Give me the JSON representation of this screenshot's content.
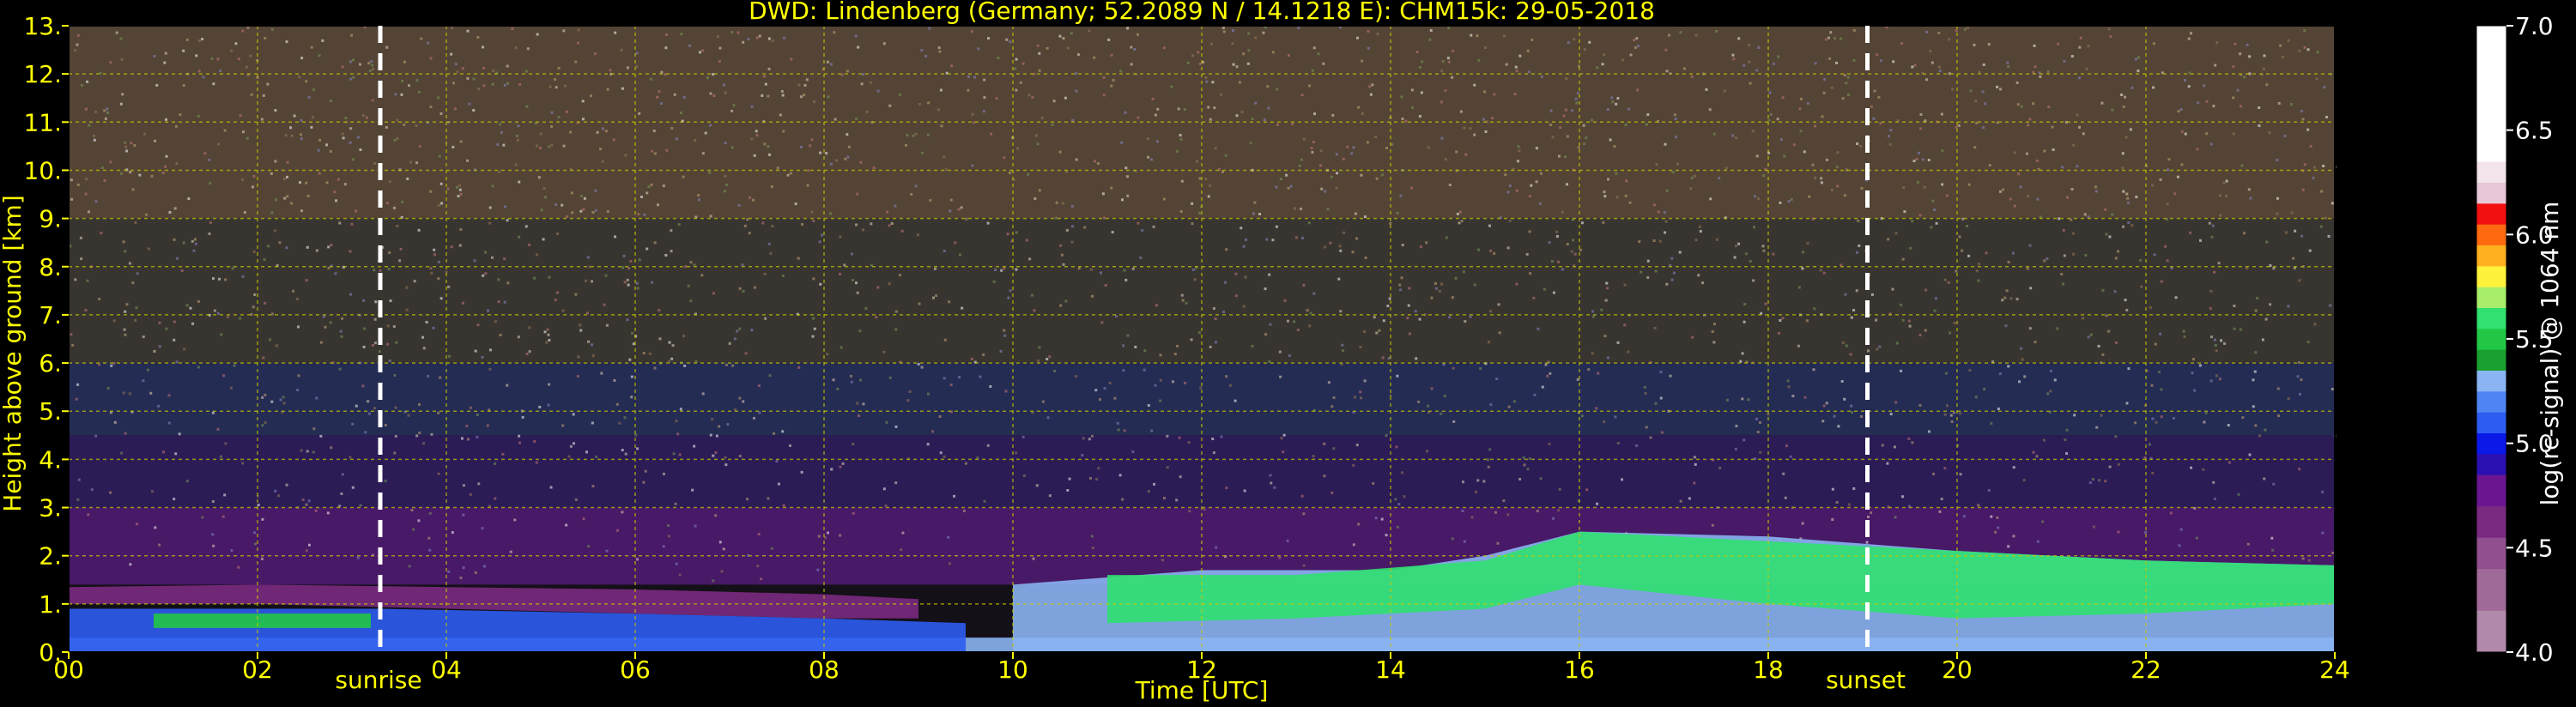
{
  "chart_data": {
    "type": "heatmap",
    "title": "DWD: Lindenberg (Germany; 52.2089 N / 14.1218 E):    CHM15k: 29-05-2018",
    "xlabel": "Time [UTC]",
    "ylabel": "Height above ground [km]",
    "xlim": [
      0,
      24
    ],
    "ylim": [
      0,
      13
    ],
    "x_ticks": [
      0,
      2,
      4,
      6,
      8,
      10,
      12,
      14,
      16,
      18,
      20,
      22,
      24
    ],
    "x_tick_labels": [
      "00",
      "02",
      "04",
      "06",
      "08",
      "10",
      "12",
      "14",
      "16",
      "18",
      "20",
      "22",
      "24"
    ],
    "y_ticks": [
      0,
      1,
      2,
      3,
      4,
      5,
      6,
      7,
      8,
      9,
      10,
      11,
      12,
      13
    ],
    "y_tick_labels": [
      "0.",
      "1.",
      "2.",
      "3.",
      "4.",
      "5.",
      "6.",
      "7.",
      "8.",
      "9.",
      "10.",
      "11.",
      "12.",
      "13."
    ],
    "grid": true,
    "markers": [
      {
        "label": "sunrise",
        "x": 3.3
      },
      {
        "label": "sunset",
        "x": 19.05
      }
    ],
    "colorbar": {
      "label": "log(rc-signal) @ 1064 nm",
      "range": [
        4.0,
        7.0
      ],
      "ticks": [
        4.0,
        4.5,
        5.0,
        5.5,
        6.0,
        6.5,
        7.0
      ],
      "tick_labels": [
        "4.0",
        "4.5",
        "5.0",
        "5.5",
        "6.0",
        "6.5",
        "7.0"
      ],
      "colors": [
        {
          "from": 4.0,
          "to": 4.2,
          "color": "#b08aa8"
        },
        {
          "from": 4.2,
          "to": 4.4,
          "color": "#a06a98"
        },
        {
          "from": 4.4,
          "to": 4.55,
          "color": "#904f8e"
        },
        {
          "from": 4.55,
          "to": 4.7,
          "color": "#7a2a80"
        },
        {
          "from": 4.7,
          "to": 4.85,
          "color": "#6b1690"
        },
        {
          "from": 4.85,
          "to": 4.95,
          "color": "#2a10b0"
        },
        {
          "from": 4.95,
          "to": 5.05,
          "color": "#0a18e8"
        },
        {
          "from": 5.05,
          "to": 5.15,
          "color": "#2c5cf0"
        },
        {
          "from": 5.15,
          "to": 5.25,
          "color": "#4f86f4"
        },
        {
          "from": 5.25,
          "to": 5.35,
          "color": "#8ab4f2"
        },
        {
          "from": 5.35,
          "to": 5.45,
          "color": "#1aa030"
        },
        {
          "from": 5.45,
          "to": 5.55,
          "color": "#22c845"
        },
        {
          "from": 5.55,
          "to": 5.65,
          "color": "#30e070"
        },
        {
          "from": 5.65,
          "to": 5.75,
          "color": "#a8ee6a"
        },
        {
          "from": 5.75,
          "to": 5.85,
          "color": "#fff23a"
        },
        {
          "from": 5.85,
          "to": 5.95,
          "color": "#ffb020"
        },
        {
          "from": 5.95,
          "to": 6.05,
          "color": "#ff6a10"
        },
        {
          "from": 6.05,
          "to": 6.15,
          "color": "#f21010"
        },
        {
          "from": 6.15,
          "to": 6.25,
          "color": "#e8c8d8"
        },
        {
          "from": 6.25,
          "to": 6.35,
          "color": "#f4e4ec"
        },
        {
          "from": 6.35,
          "to": 7.0,
          "color": "#ffffff"
        }
      ]
    },
    "layers": [
      {
        "name": "near-surface",
        "x": [
          0,
          24
        ],
        "y_bottom": [
          0,
          0
        ],
        "y_top": [
          0.3,
          0.3
        ],
        "value": 5.25
      },
      {
        "name": "boundary-layer-night",
        "x": [
          0,
          3.3,
          6,
          8,
          9.5
        ],
        "y_top": [
          0.9,
          0.9,
          0.8,
          0.7,
          0.6
        ],
        "value": 5.1
      },
      {
        "name": "residual-layer",
        "x": [
          0,
          2,
          4,
          6,
          8,
          9
        ],
        "y_bottom": [
          1.0,
          1.0,
          0.9,
          0.8,
          0.7,
          0.7
        ],
        "y_top": [
          1.35,
          1.4,
          1.35,
          1.3,
          1.2,
          1.1
        ],
        "value": 4.6
      },
      {
        "name": "green-layer-morning",
        "x": [
          0.9,
          3.2
        ],
        "y_bottom": [
          0.5,
          0.5
        ],
        "y_top": [
          0.8,
          0.8
        ],
        "value": 5.5
      },
      {
        "name": "convective-bl",
        "x": [
          10,
          12,
          14,
          15,
          16,
          18,
          20,
          22,
          24
        ],
        "y_top": [
          1.4,
          1.7,
          1.7,
          2.0,
          2.5,
          2.4,
          2.1,
          1.9,
          1.8
        ],
        "value": 5.3
      },
      {
        "name": "green-clouds",
        "x": [
          11,
          13,
          15,
          16,
          18,
          20,
          22,
          24
        ],
        "y_bottom": [
          0.6,
          0.7,
          0.9,
          1.4,
          1.0,
          0.7,
          0.8,
          1.0
        ],
        "y_top": [
          1.6,
          1.6,
          1.9,
          2.5,
          2.3,
          2.1,
          1.9,
          1.8
        ],
        "value": 5.55
      }
    ]
  }
}
